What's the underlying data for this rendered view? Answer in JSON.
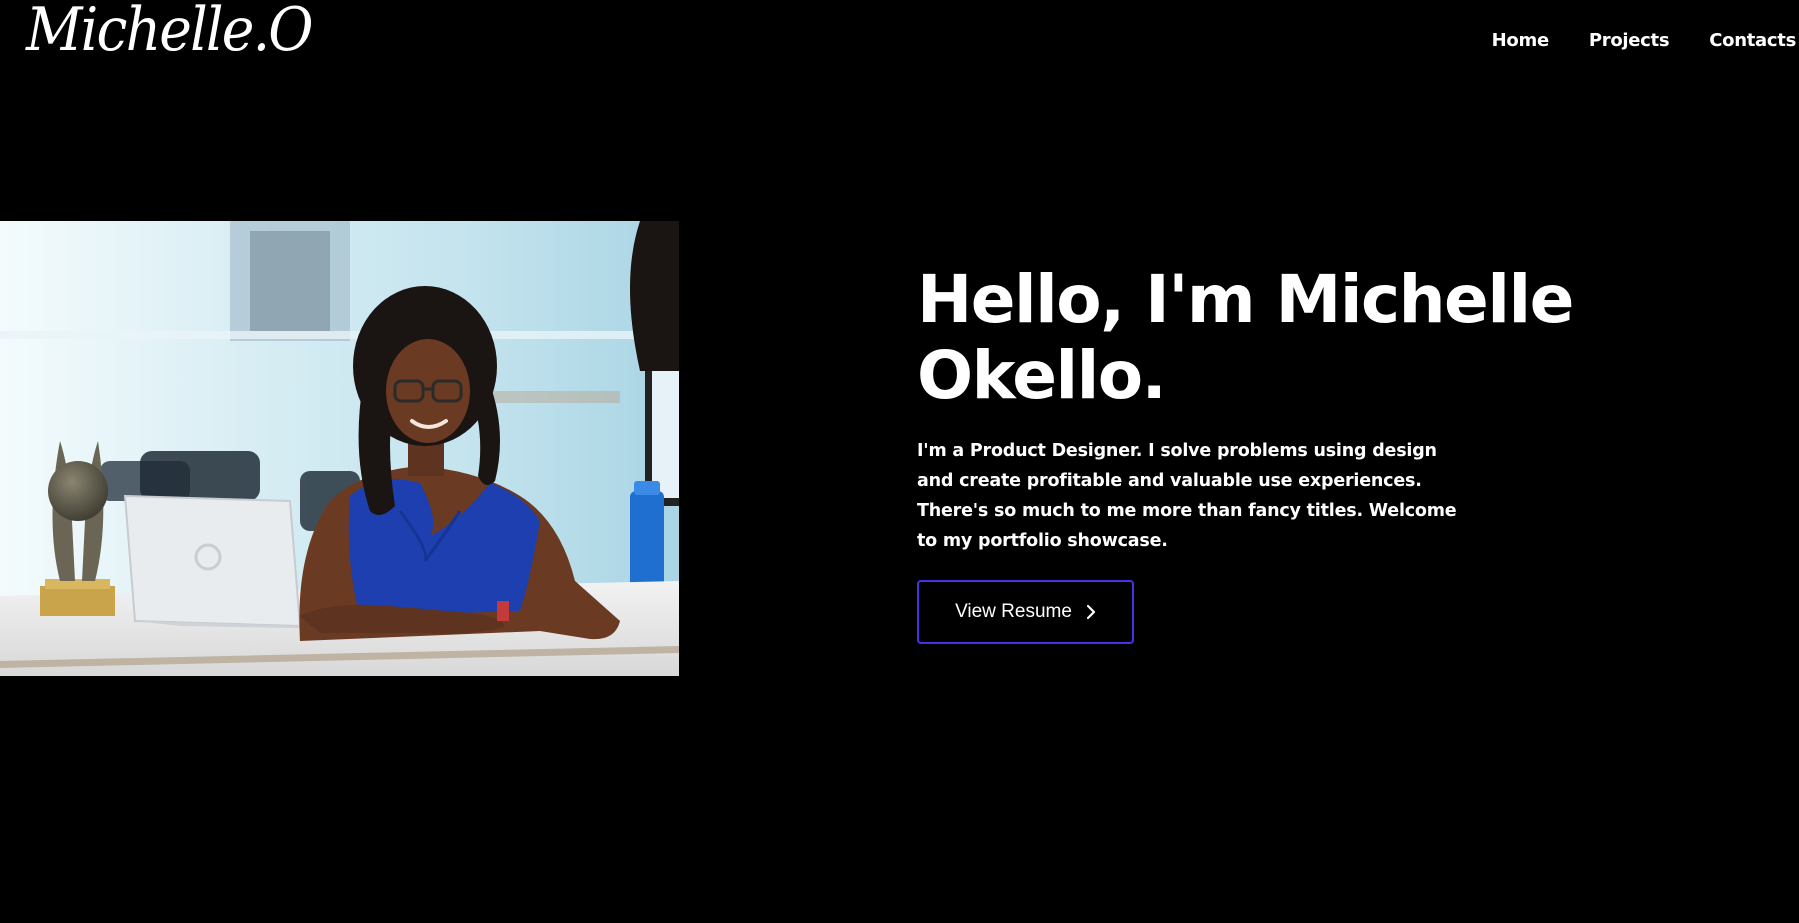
{
  "header": {
    "logo_text": "Michelle.O",
    "nav": [
      {
        "label": "Home"
      },
      {
        "label": "Projects"
      },
      {
        "label": "Contacts"
      }
    ]
  },
  "hero": {
    "title_line1": "Hello, I'm Michelle",
    "title_line2": "Okello.",
    "description": "I'm a Product Designer. I solve problems using design and create profitable and valuable use experiences. There's so much to me more than fancy titles. Welcome to my portfolio showcase.",
    "button_label": "View Resume",
    "button_icon": "chevron-right-icon"
  },
  "photo": {
    "icon": "portrait-photo"
  },
  "colors": {
    "background": "#000000",
    "text": "#ffffff",
    "button_border": "#4d2ee6"
  }
}
